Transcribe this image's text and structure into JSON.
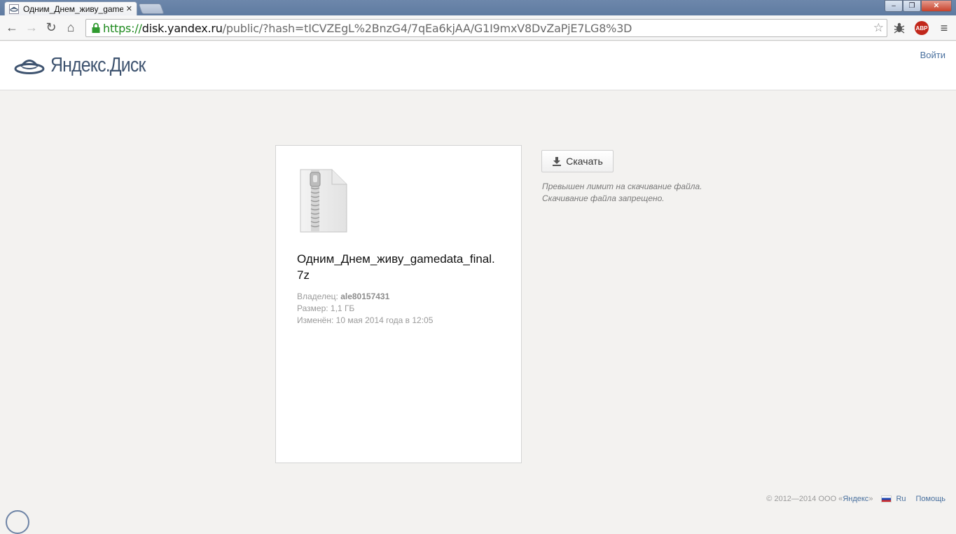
{
  "browser": {
    "tab_title": "Одним_Днем_живу_game",
    "tab_close": "✕",
    "url_scheme": "https://",
    "url_host": "disk.yandex.ru",
    "url_path": "/public/?hash=tICVZEgL%2BnzG4/7qEa6kjAA/G1I9mxV8DvZaPjE7LG8%3D",
    "nav_back": "←",
    "nav_forward": "→",
    "nav_reload": "↻",
    "nav_home": "⌂",
    "star": "☆",
    "abp_label": "ABP",
    "menu": "≡",
    "window_controls": [
      "–",
      "❐",
      "✕"
    ]
  },
  "header": {
    "logo_text": "Яндекс.Диск",
    "login_link": "Войти"
  },
  "file": {
    "name": "Одним_Днем_живу_gamedata_final.7z",
    "owner_label": "Владелец:",
    "owner_value": "ale80157431",
    "size_label": "Размер:",
    "size_value": "1,1 ГБ",
    "modified_label": "Изменён:",
    "modified_value": "10 мая 2014 года в 12:05"
  },
  "download": {
    "button_label": "Скачать",
    "warning": "Превышен лимит на скачивание файла. Скачивание файла запрещено."
  },
  "footer": {
    "copyright": "© 2012—2014 ООО «",
    "company_link": "Яндекс",
    "copyright_end": "»",
    "language_link": "Ru",
    "help_link": "Помощь"
  },
  "colors": {
    "link": "#49709e",
    "logo": "#3f5470",
    "page_bg": "#f3f2f0"
  }
}
